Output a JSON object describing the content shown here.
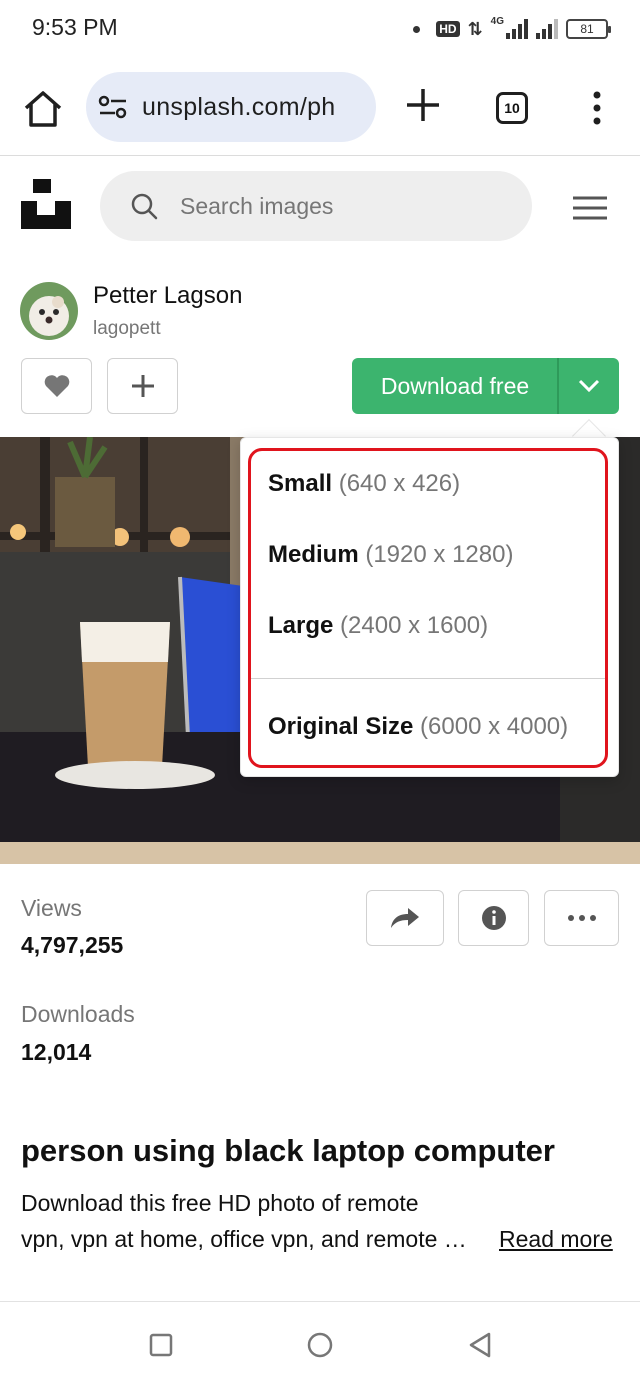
{
  "status_bar": {
    "time": "9:53 PM",
    "hd_badge": "HD",
    "network_type": "4G",
    "battery_level": "81"
  },
  "browser": {
    "url": "unsplash.com/ph",
    "tab_count": "10"
  },
  "site": {
    "search_placeholder": "Search images"
  },
  "author": {
    "name": "Petter Lagson",
    "handle": "lagopett"
  },
  "actions": {
    "download_label": "Download free"
  },
  "download_menu": {
    "items": [
      {
        "label": "Small",
        "dims": "(640 x 426)"
      },
      {
        "label": "Medium",
        "dims": "(1920 x 1280)"
      },
      {
        "label": "Large",
        "dims": "(2400 x 1600)"
      },
      {
        "label": "Original Size",
        "dims": "(6000 x 4000)"
      }
    ]
  },
  "stats": {
    "views_label": "Views",
    "views_value": "4,797,255",
    "downloads_label": "Downloads",
    "downloads_value": "12,014"
  },
  "photo_info": {
    "title": "person using black laptop computer",
    "description_line1": "Download this free HD photo of remote",
    "description_line2": "vpn, vpn at home, office vpn, and remote …",
    "read_more": "Read more"
  },
  "colors": {
    "download_green": "#3cb46e",
    "highlight_red": "#e0141d",
    "url_pill_bg": "#e6ebf7"
  }
}
